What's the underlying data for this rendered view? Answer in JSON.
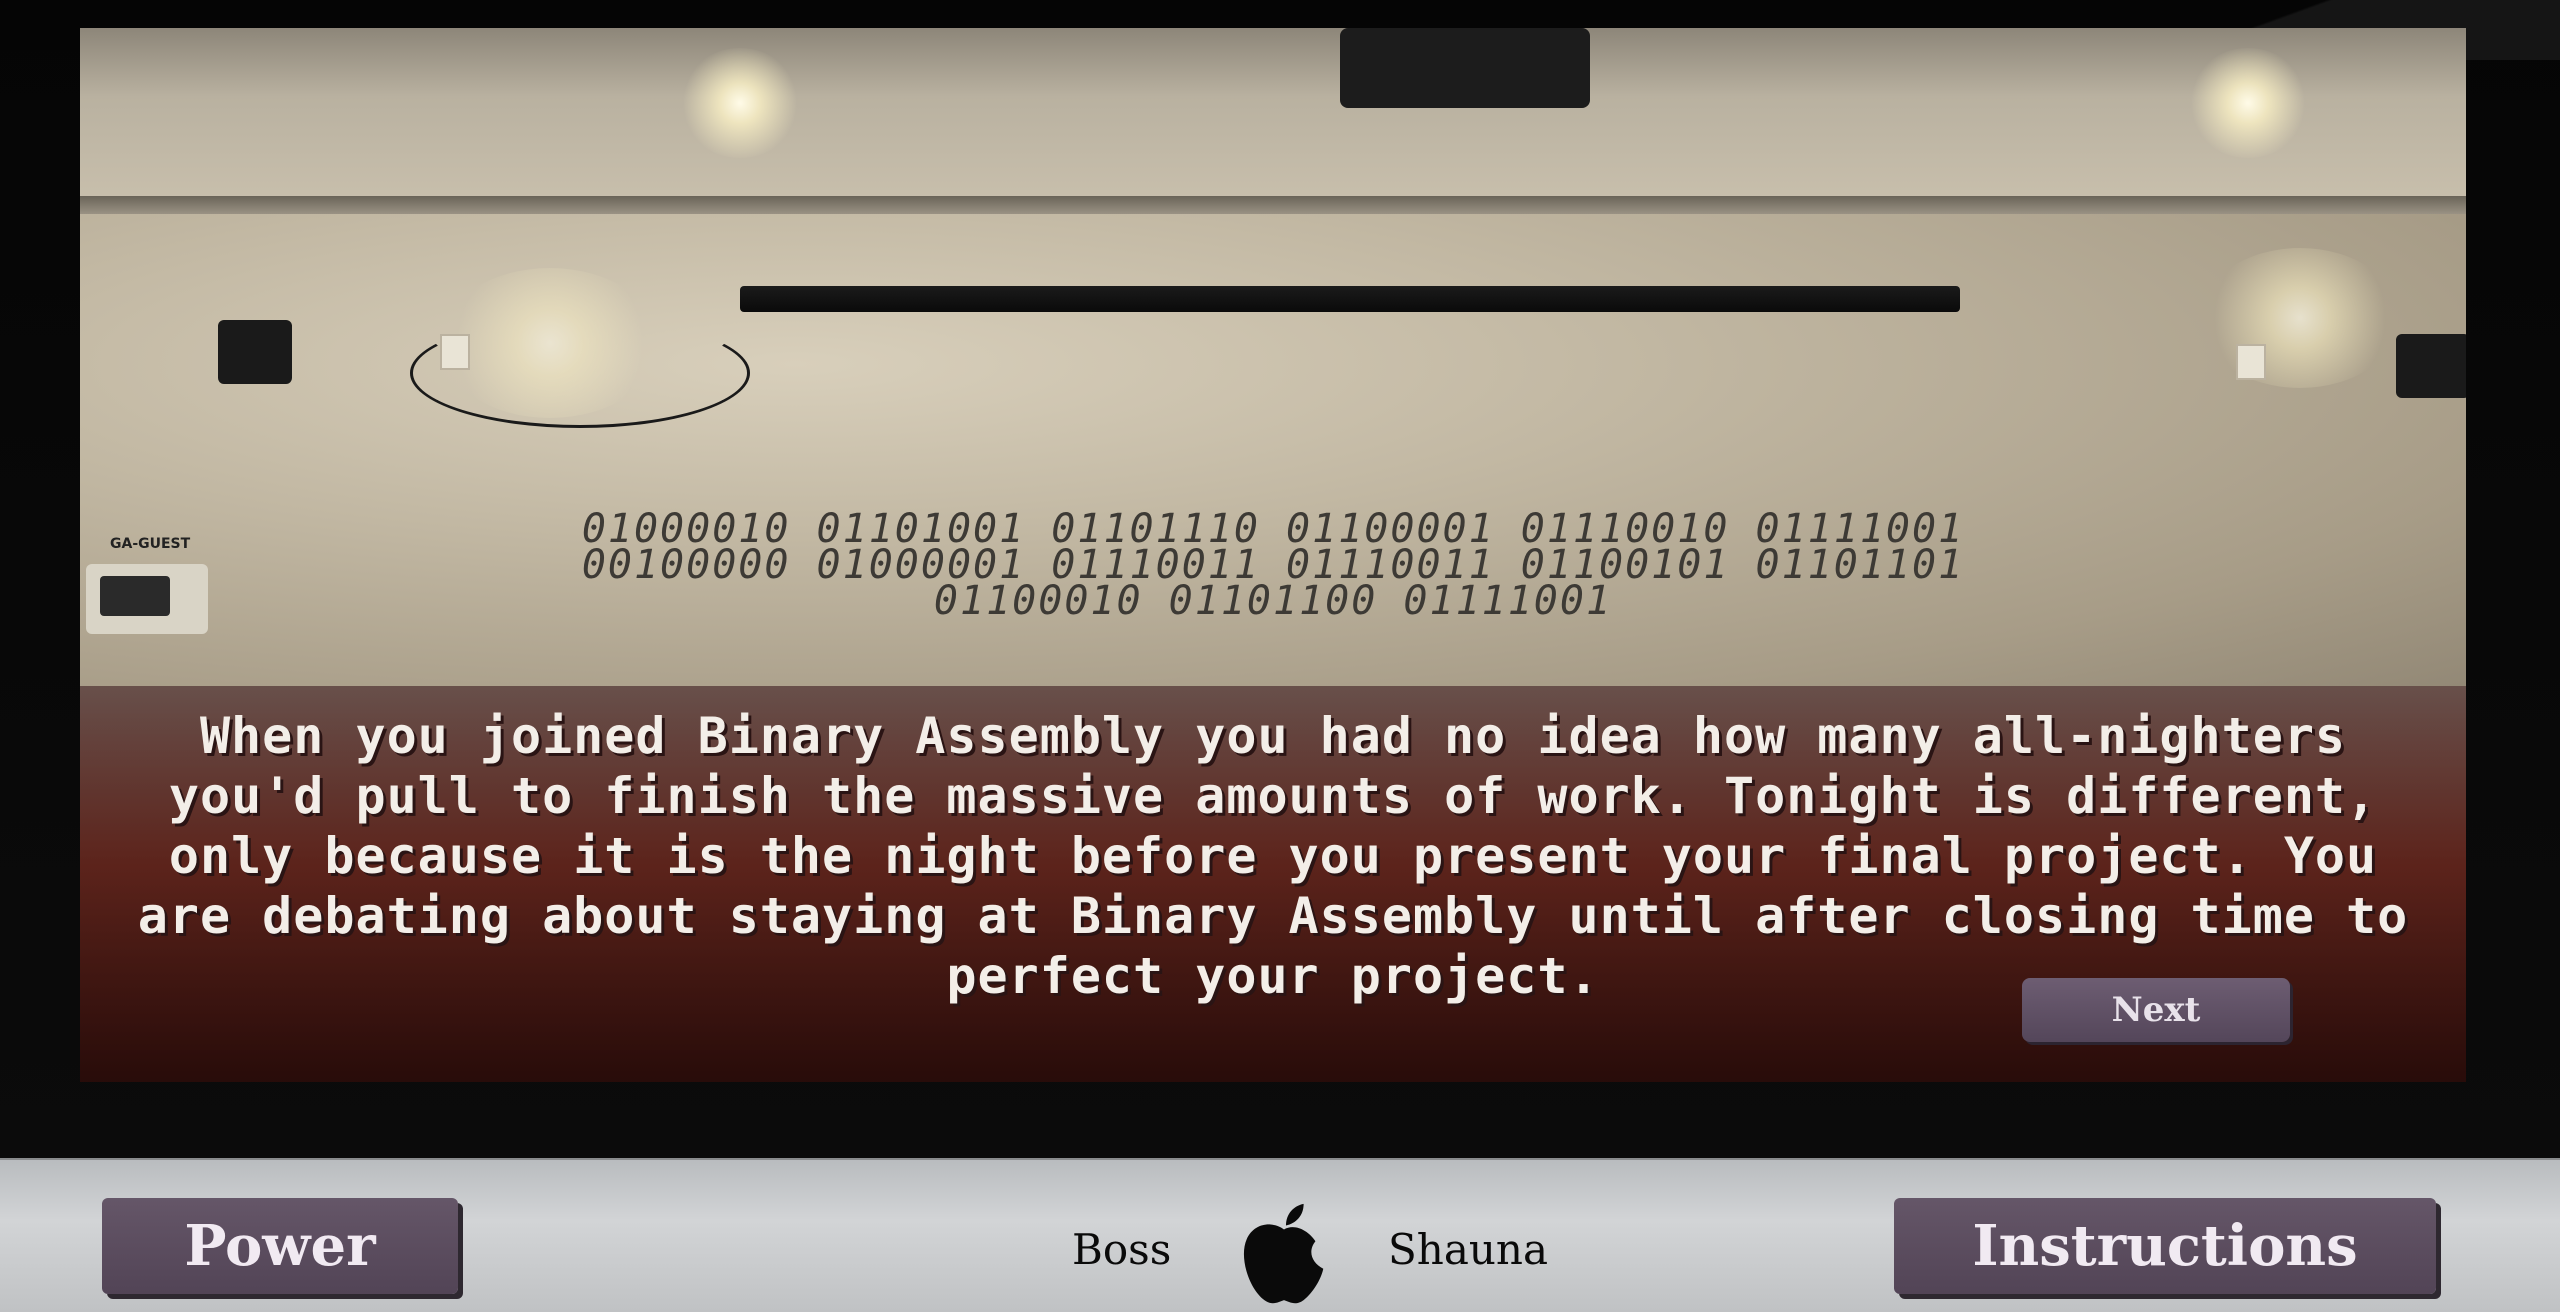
{
  "dialog": {
    "text": "When you joined Binary Assembly you had no idea how many all-nighters you'd pull to finish the massive amounts of work. Tonight is different, only because it is the night before you present your final project. You are debating about staying at Binary Assembly until after closing time to perfect your project.",
    "next_label": "Next"
  },
  "scene": {
    "binary_lines": [
      "01000010 01101001 01101110 01100001 01110010 01111001",
      "00100000 01000001 01110011 01110011 01100101 01101101",
      "01100010 01101100 01111001"
    ],
    "router_label": "GA-GUEST"
  },
  "control_bar": {
    "power_label": "Power",
    "instructions_label": "Instructions",
    "brand_left": "Boss",
    "brand_right": "Shauna",
    "brand_icon": "apple-logo-icon"
  },
  "colors": {
    "button_bg": "#5c4e60",
    "bar_bg": "#c8cacc",
    "text_light": "#f3eee8"
  }
}
